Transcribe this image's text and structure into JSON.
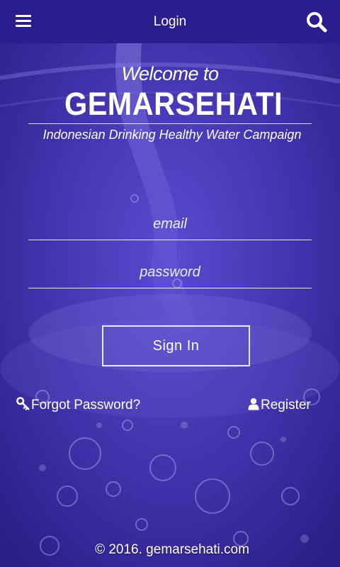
{
  "header": {
    "title": "Login",
    "menu_icon": "hamburger-menu-icon",
    "search_icon": "search-icon"
  },
  "hero": {
    "welcome": "Welcome to",
    "brand": "GEMARSEHATI",
    "tagline": "Indonesian Drinking Healthy Water Campaign"
  },
  "form": {
    "email_placeholder": "email",
    "email_value": "",
    "password_placeholder": "password",
    "password_value": "",
    "signin_label": "Sign In"
  },
  "links": {
    "forgot_label": "Forgot Password?",
    "forgot_icon": "key-icon",
    "register_label": "Register",
    "register_icon": "user-icon"
  },
  "footer": {
    "copyright": "© 2016. gemarsehati.com"
  },
  "colors": {
    "topbar": "#2b1d8e",
    "background_tint": "#3e2fa6",
    "text": "#ffffff"
  }
}
